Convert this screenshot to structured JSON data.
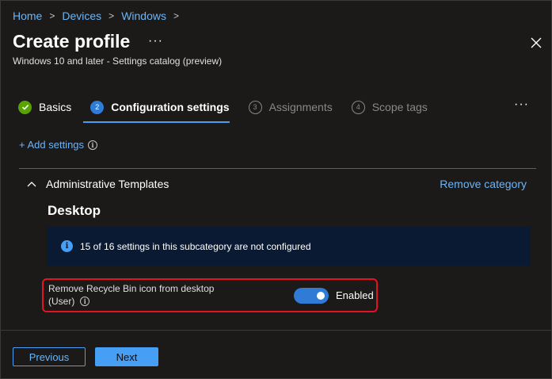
{
  "breadcrumb": [
    "Home",
    "Devices",
    "Windows"
  ],
  "header": {
    "title": "Create profile",
    "more": "···",
    "subtitle": "Windows 10 and later - Settings catalog (preview)"
  },
  "steps": [
    {
      "label": "Basics",
      "status": "done",
      "number": "1"
    },
    {
      "label": "Configuration settings",
      "status": "active",
      "number": "2"
    },
    {
      "label": "Assignments",
      "status": "pending",
      "number": "3"
    },
    {
      "label": "Scope tags",
      "status": "pending",
      "number": "4"
    }
  ],
  "steps_more": "···",
  "add_settings": "+ Add settings",
  "category": {
    "name": "Administrative Templates",
    "remove_label": "Remove category"
  },
  "subcategory": {
    "title": "Desktop",
    "info": "15 of 16 settings in this subcategory are not configured"
  },
  "setting": {
    "label_line1": "Remove Recycle Bin icon from desktop",
    "label_line2": "(User)",
    "state_label": "Enabled",
    "enabled": true
  },
  "footer": {
    "previous": "Previous",
    "next": "Next"
  },
  "colors": {
    "accent": "#479ef5",
    "success": "#57a300",
    "highlight": "#e81123"
  },
  "icons": {
    "close": "close-icon",
    "checkmark": "checkmark-icon",
    "info": "info-icon",
    "chevron": "chevron-up-icon"
  }
}
